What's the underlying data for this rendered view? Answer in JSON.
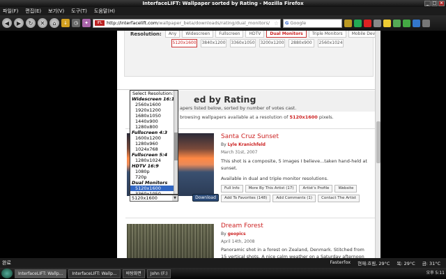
{
  "window": {
    "title": "InterfaceLIFT: Wallpaper sorted by Rating - Mozilla Firefox"
  },
  "menu": [
    "파일(F)",
    "편집(E)",
    "보기(V)",
    "도구(T)",
    "도움말(H)"
  ],
  "url": {
    "host": "http://interfacelift.com",
    "path": "/wallpaper_beta/downloads/rating/dual_monitors/"
  },
  "search": {
    "engine": "G",
    "placeholder": "Google"
  },
  "filters": {
    "label": "Resolution:",
    "types": [
      "Any",
      "Widescreen",
      "Fullscreen",
      "HDTV",
      "Dual Monitors",
      "Triple Monitors",
      "Mobile Devices"
    ],
    "active_type": "Dual Monitors",
    "resolutions": [
      "5120x1600",
      "3840x1200",
      "3360x1050",
      "3200x1200",
      "2880x900",
      "2560x1024"
    ],
    "active_resolution": "5120x1600"
  },
  "heading": "ed by Rating",
  "intro_line1": "apers listed below, sorted by number of votes cast.",
  "intro_line2_pre": "browsing wallpapers available at a resolution of",
  "intro_line2_res": "5120x1600",
  "intro_line2_post": "pixels.",
  "dropdown": {
    "items": [
      {
        "text": "Select Resolution:",
        "kind": "head"
      },
      {
        "text": "Widescreen 16:10",
        "kind": "grp"
      },
      {
        "text": "2560x1600",
        "kind": "opt"
      },
      {
        "text": "1920x1200",
        "kind": "opt"
      },
      {
        "text": "1680x1050",
        "kind": "opt"
      },
      {
        "text": "1440x900",
        "kind": "opt"
      },
      {
        "text": "1280x800",
        "kind": "opt"
      },
      {
        "text": "Fullscreen 4:3",
        "kind": "grp"
      },
      {
        "text": "1600x1200",
        "kind": "opt"
      },
      {
        "text": "1280x960",
        "kind": "opt"
      },
      {
        "text": "1024x768",
        "kind": "opt"
      },
      {
        "text": "Fullscreen 5:4",
        "kind": "grp"
      },
      {
        "text": "1280x1024",
        "kind": "opt"
      },
      {
        "text": "HDTV 16:9",
        "kind": "grp"
      },
      {
        "text": "1080p",
        "kind": "opt"
      },
      {
        "text": "720p",
        "kind": "opt"
      },
      {
        "text": "Dual Monitors",
        "kind": "grp"
      },
      {
        "text": "5120x1600",
        "kind": "sel"
      },
      {
        "text": "3360x1050",
        "kind": "opt"
      }
    ],
    "selected": "5120x1600"
  },
  "download_label": "Download",
  "wallpapers": [
    {
      "title": "Santa Cruz Sunset",
      "by_prefix": "By",
      "author": "Lyle Kranichfeld",
      "date": "March 31st, 2007",
      "desc1": "This shot is a composite, 5 images I believe...taken hand-held at sunset.",
      "desc2": "Available in dual and triple monitor resolutions.",
      "actions": [
        "Full Info",
        "More By This Artist (17)",
        "Artist's Profile",
        "Website",
        "Add To Favorites (148)",
        "Add Comments (1)",
        "Contact The Artist"
      ]
    },
    {
      "title": "Dream Forest",
      "by_prefix": "By",
      "author": "geopics",
      "date": "April 14th, 2008",
      "desc1": "Panoramic shot in a forest on Zealand, Denmark. Stitched from 15 vertical shots. A nice calm weather on a Saturday afternoon with the"
    }
  ],
  "status": {
    "text": "완료",
    "addon": "Fasterfox",
    "weather1": "현재:흐림, 29°C",
    "weather2": "목: 29°C",
    "weather3": "금: 31°C"
  },
  "taskbar": {
    "buttons": [
      "InterfaceLIFT: Wallp...",
      "InterfaceLIFT: Wallp...",
      "바탕화면",
      "John (F:)"
    ],
    "clock": "오후 5:11"
  }
}
